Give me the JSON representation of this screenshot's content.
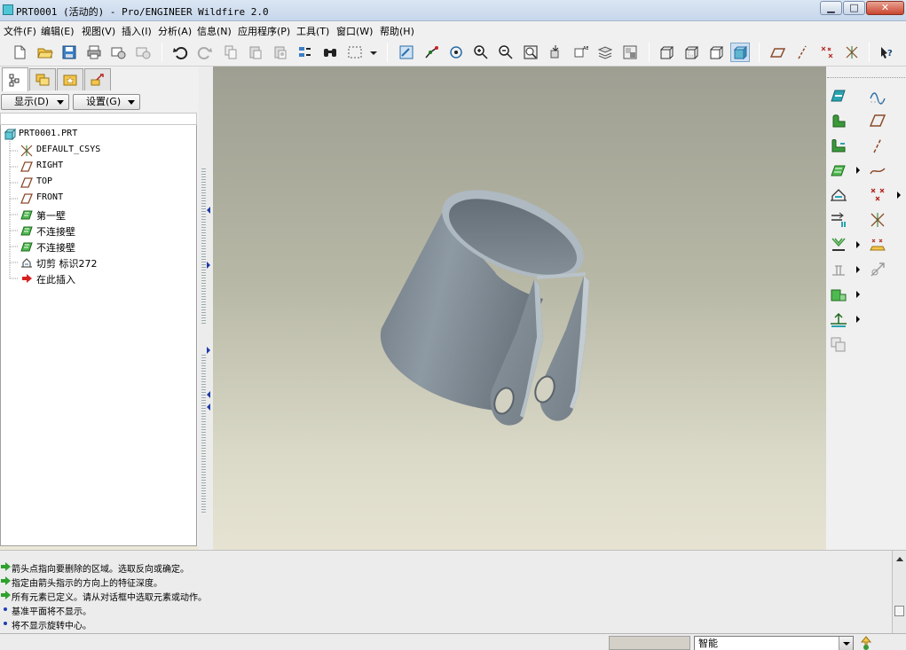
{
  "window": {
    "title": "PRT0001 (活动的) - Pro/ENGINEER Wildfire 2.0",
    "minimize_glyph": "▁",
    "maximize_glyph": "□",
    "close_glyph": "✕"
  },
  "menubar": {
    "items": [
      {
        "label": "文件(F)"
      },
      {
        "label": "编辑(E)"
      },
      {
        "label": "视图(V)"
      },
      {
        "label": "插入(I)"
      },
      {
        "label": "分析(A)"
      },
      {
        "label": "信息(N)"
      },
      {
        "label": "应用程序(P)"
      },
      {
        "label": "工具(T)"
      },
      {
        "label": "窗口(W)"
      },
      {
        "label": "帮助(H)"
      }
    ]
  },
  "navigator": {
    "show_button": "显示(D)",
    "settings_button": "设置(G)"
  },
  "model_tree": {
    "items": [
      {
        "label": "PRT0001.PRT",
        "icon": "part-icon"
      },
      {
        "label": "DEFAULT_CSYS",
        "icon": "csys-icon"
      },
      {
        "label": "RIGHT",
        "icon": "datum-plane-icon"
      },
      {
        "label": "TOP",
        "icon": "datum-plane-icon"
      },
      {
        "label": "FRONT",
        "icon": "datum-plane-icon"
      },
      {
        "label": "第一壁",
        "icon": "sheetmetal-wall-icon"
      },
      {
        "label": "不连接壁",
        "icon": "sheetmetal-wall-icon"
      },
      {
        "label": "不连接壁",
        "icon": "sheetmetal-wall-icon"
      },
      {
        "label": "切剪 标识272",
        "icon": "cut-icon"
      },
      {
        "label": "在此插入",
        "icon": "insert-here-arrow-icon"
      }
    ]
  },
  "messages": {
    "items": [
      {
        "text": "箭头点指向要删除的区域。选取反向或确定。",
        "icon": "message-arrow-icon"
      },
      {
        "text": "指定由箭头指示的方向上的特征深度。",
        "icon": "message-arrow-icon"
      },
      {
        "text": "所有元素已定义。请从对话框中选取元素或动作。",
        "icon": "message-arrow-icon"
      },
      {
        "text": "基准平面将不显示。",
        "icon": "info-dot-icon"
      },
      {
        "text": "将不显示旋转中心。",
        "icon": "info-dot-icon"
      }
    ]
  },
  "statusbar": {
    "filter_value": "智能"
  },
  "colors": {
    "part_body": "#7f8a93",
    "part_highlight": "#aab6bf",
    "accent_teal": "#2aa3b2",
    "sheetmetal_green": "#3a9a3a",
    "datum_brown": "#8a4b2a"
  }
}
